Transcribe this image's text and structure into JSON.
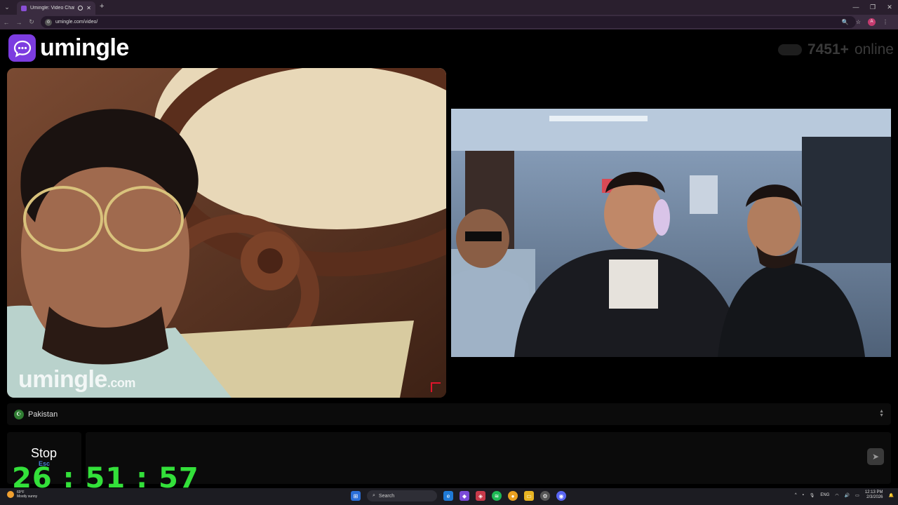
{
  "browser": {
    "tab_title": "Umingle: Video Chat with S",
    "url": "umingle.com/video/"
  },
  "app": {
    "logo_text": "umingle",
    "online_count": "7451+",
    "online_label": "online",
    "watermark_main": "umingle",
    "watermark_suffix": ".com"
  },
  "country": {
    "name": "Pakistan"
  },
  "controls": {
    "stop_label": "Stop",
    "stop_key": "Esc",
    "send_icon": "send-arrow",
    "timer": "26 : 51 : 57"
  },
  "taskbar": {
    "weather_temp": "69°F",
    "weather_desc": "Mostly sunny",
    "search_label": "Search",
    "lang": "ENG",
    "time": "12:13 PM",
    "date": "2/3/2026"
  },
  "colors": {
    "brand": "#7c3ce0",
    "timer": "#33e03a",
    "report": "#e0142b"
  }
}
